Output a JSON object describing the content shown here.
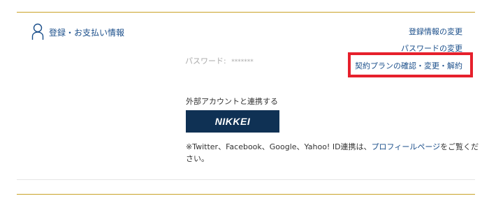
{
  "section": {
    "title": "登録・お支払い情報",
    "icon": "user-icon"
  },
  "links": {
    "change_registration": "登録情報の変更",
    "change_password": "パスワードの変更",
    "contract_plan": "契約プランの確認・変更・解約"
  },
  "password": {
    "label": "パスワード:",
    "masked_value": "*******"
  },
  "external": {
    "heading": "外部アカウントと連携する",
    "nikkei_button": "NIKKEI"
  },
  "note": {
    "prefix": "※Twitter、Facebook、Google、Yahoo! ID連携は、",
    "link_text": "プロフィールページ",
    "suffix": "をご覧ください。"
  },
  "colors": {
    "accent_gold": "#c9a227",
    "link_blue": "#1a4e8a",
    "highlight_red": "#e6202c",
    "nikkei_navy": "#0f3154"
  }
}
